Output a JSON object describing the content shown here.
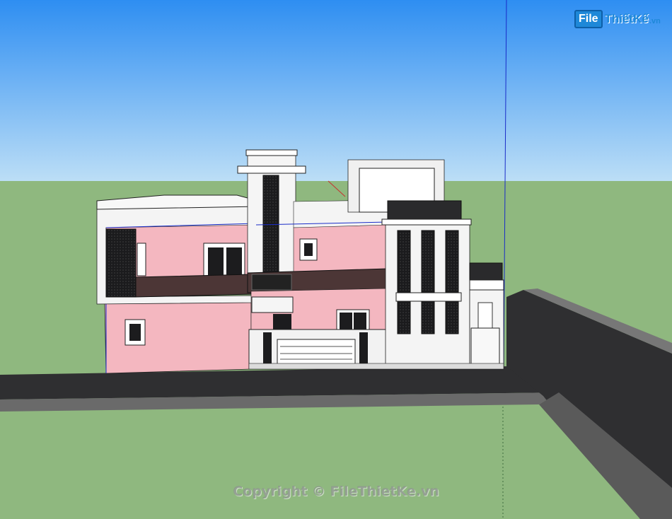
{
  "watermark": {
    "logo_box": "File",
    "logo_rest": "ThiếtKế",
    "logo_tld": ".vn",
    "copyright": "Copyright © FileThietKe.vn"
  },
  "colors": {
    "sky_top": "#2f8ff2",
    "sky_bottom": "#b9dcf6",
    "ground": "#8fb87f",
    "road": "#2e2e30",
    "curb": "#6e6e6e",
    "wall_pink": "#f4b6bf",
    "wall_white": "#f2f2f2",
    "window_dark": "#1c1c1e",
    "railing": "#4a3535"
  }
}
